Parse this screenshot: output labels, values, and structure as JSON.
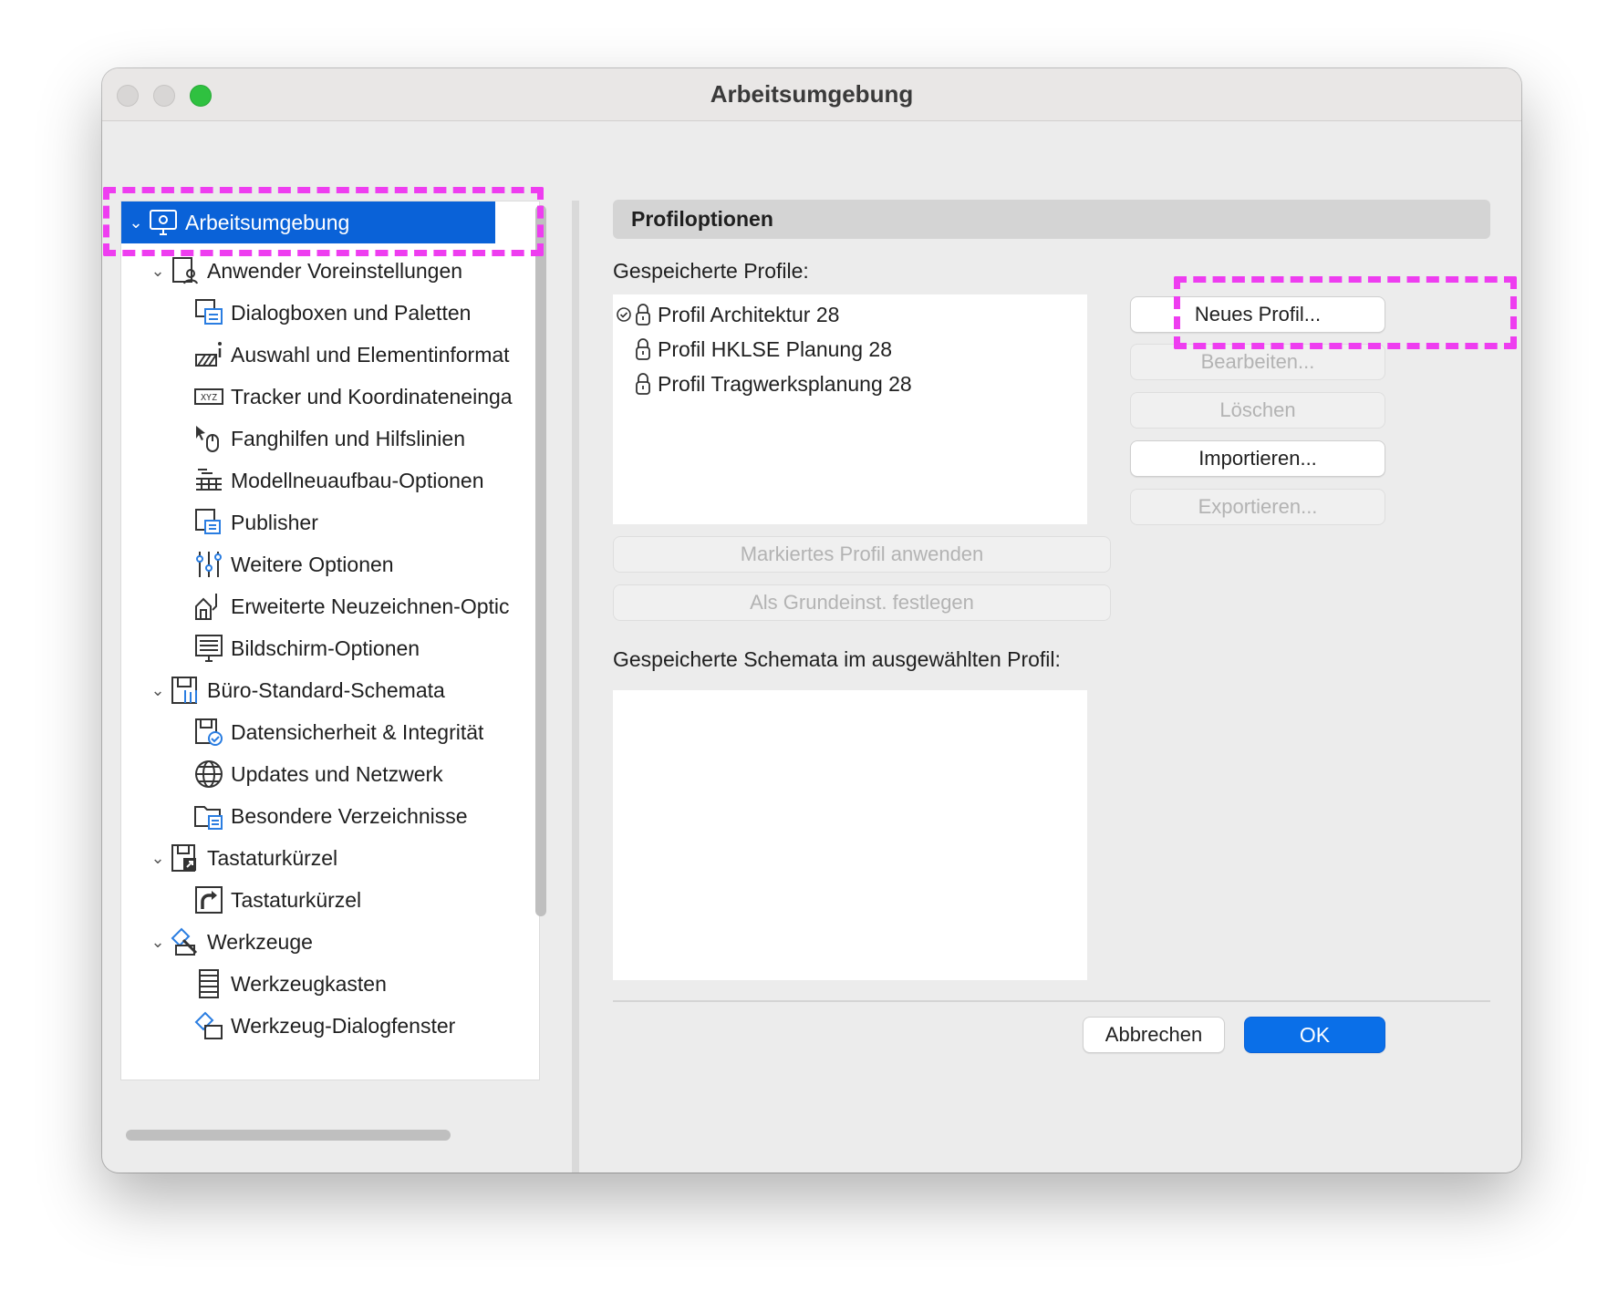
{
  "window": {
    "title": "Arbeitsumgebung"
  },
  "tree": [
    {
      "label": "Arbeitsumgebung",
      "level": 0,
      "expanded": true,
      "selected": true,
      "icon": "monitor-gear-icon"
    },
    {
      "label": "Anwender Voreinstellungen",
      "level": 1,
      "expanded": true,
      "icon": "user-settings-icon"
    },
    {
      "label": "Dialogboxen und Paletten",
      "level": 2,
      "icon": "dialog-palettes-icon"
    },
    {
      "label": "Auswahl und Elementinformat",
      "level": 2,
      "icon": "selection-info-icon"
    },
    {
      "label": "Tracker und Koordinateneinga",
      "level": 2,
      "icon": "xyz-tracker-icon"
    },
    {
      "label": "Fanghilfen und Hilfslinien",
      "level": 2,
      "icon": "snap-guides-icon"
    },
    {
      "label": "Modellneuaufbau-Optionen",
      "level": 2,
      "icon": "rebuild-icon"
    },
    {
      "label": "Publisher",
      "level": 2,
      "icon": "publisher-icon"
    },
    {
      "label": "Weitere Optionen",
      "level": 2,
      "icon": "sliders-icon"
    },
    {
      "label": "Erweiterte Neuzeichnen-Optic",
      "level": 2,
      "icon": "redraw-icon"
    },
    {
      "label": "Bildschirm-Optionen",
      "level": 2,
      "icon": "screen-options-icon"
    },
    {
      "label": "Büro-Standard-Schemata",
      "level": 1,
      "expanded": true,
      "icon": "company-standards-icon"
    },
    {
      "label": "Datensicherheit & Integrität",
      "level": 2,
      "icon": "data-safety-icon"
    },
    {
      "label": "Updates und Netzwerk",
      "level": 2,
      "icon": "globe-icon"
    },
    {
      "label": "Besondere Verzeichnisse",
      "level": 2,
      "icon": "folder-icon"
    },
    {
      "label": "Tastaturkürzel",
      "level": 1,
      "expanded": true,
      "icon": "shortcuts-icon"
    },
    {
      "label": "Tastaturkürzel",
      "level": 2,
      "icon": "shortcut-arrow-icon"
    },
    {
      "label": "Werkzeuge",
      "level": 1,
      "expanded": true,
      "icon": "tools-icon"
    },
    {
      "label": "Werkzeugkasten",
      "level": 2,
      "icon": "toolbox-icon"
    },
    {
      "label": "Werkzeug-Dialogfenster",
      "level": 2,
      "icon": "tool-dialog-icon"
    }
  ],
  "profile_options": {
    "header": "Profiloptionen",
    "saved_profiles_label": "Gespeicherte Profile:",
    "profiles": [
      {
        "label": "Profil Architektur 28",
        "locked": true,
        "active": true
      },
      {
        "label": "Profil HKLSE Planung 28",
        "locked": true,
        "active": false
      },
      {
        "label": "Profil Tragwerksplanung 28",
        "locked": true,
        "active": false
      }
    ],
    "buttons": {
      "new": "Neues Profil...",
      "edit": "Bearbeiten...",
      "delete": "Löschen",
      "import": "Importieren...",
      "export": "Exportieren...",
      "apply": "Markiertes Profil anwenden",
      "set_default": "Als Grundeinst. festlegen"
    },
    "schemes_label": "Gespeicherte Schemata im ausgewählten Profil:"
  },
  "footer": {
    "cancel": "Abbrechen",
    "ok": "OK"
  },
  "colors": {
    "selection": "#0a62d8",
    "primary_button": "#0a6fe8",
    "annotation": "#ee3df0"
  }
}
